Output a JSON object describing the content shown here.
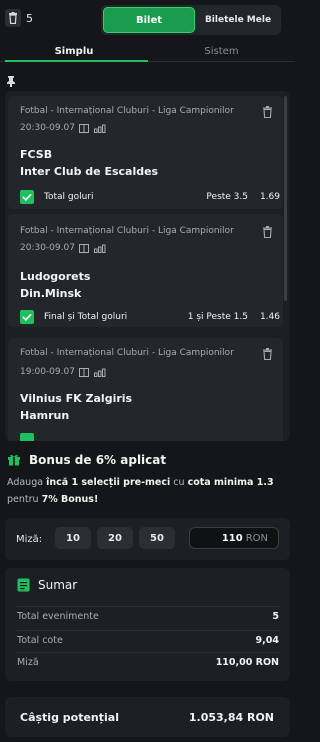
{
  "header": {
    "count": "5",
    "segments": [
      "Bilet",
      "Biletele Mele"
    ],
    "tabs": [
      "Simplu",
      "Sistem"
    ]
  },
  "bets": [
    {
      "league": "Fotbal - Internațional Cluburi - Liga Campionilor",
      "time": "20:30-09.07",
      "home": "FCSB",
      "away": "Inter Club de Escaldes",
      "market": "Total goluri",
      "selection": "Peste 3.5",
      "odd": "1.69"
    },
    {
      "league": "Fotbal - Internațional Cluburi - Liga Campionilor",
      "time": "20:30-09.07",
      "home": "Ludogorets",
      "away": "Din.Minsk",
      "market": "Final și Total goluri",
      "selection": "1 și Peste 1.5",
      "odd": "1.46"
    },
    {
      "league": "Fotbal - Internațional Cluburi - Liga Campionilor",
      "time": "19:00-09.07",
      "home": "Vilnius FK Zalgiris",
      "away": "Hamrun"
    }
  ],
  "bonus": {
    "title": "Bonus de 6% aplicat",
    "text_1": "Adauga ",
    "text_bold_1": "încă 1 selecții pre-meci",
    "text_2": " cu ",
    "text_bold_2": "cota minima 1.3",
    "text_3": " pentru ",
    "text_bold_3": "7% Bonus!"
  },
  "stake": {
    "label": "Miză:",
    "chips": [
      "10",
      "20",
      "50"
    ],
    "amount": "110",
    "currency": "RON"
  },
  "summary": {
    "title": "Sumar",
    "rows": [
      {
        "label": "Total evenimente",
        "value": "5"
      },
      {
        "label": "Total cote",
        "value": "9,04"
      },
      {
        "label": "Miză",
        "value": "110,00 RON"
      }
    ]
  },
  "potential": {
    "label": "Câștig potențial",
    "value": "1.053,84 RON"
  },
  "colors": {
    "accent": "#1fbf5f",
    "background": "#141619",
    "panel": "#1c1f23"
  }
}
